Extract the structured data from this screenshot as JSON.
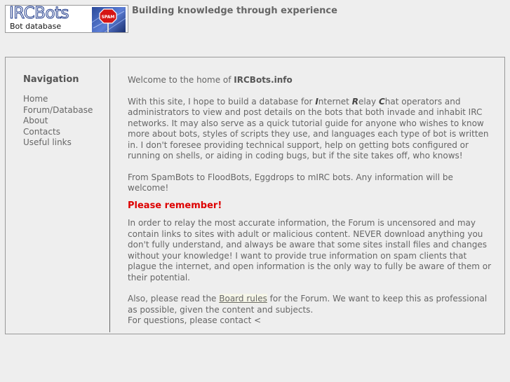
{
  "header": {
    "logo_title": "IRCBots",
    "logo_subtitle": "Bot database",
    "logo_image": "spam-sign-image",
    "tagline": "Building knowledge through experience"
  },
  "nav": {
    "title": "Navigation",
    "items": [
      {
        "label": "Home"
      },
      {
        "label": "Forum/Database"
      },
      {
        "label": "About"
      },
      {
        "label": "Contacts"
      },
      {
        "label": "Useful links"
      }
    ]
  },
  "main": {
    "welcome_prefix": "Welcome to the home of ",
    "welcome_site": "IRCBots.info",
    "intro_1": "With this site, I hope to build a database for ",
    "intro_I": "I",
    "intro_nternet": "nternet ",
    "intro_R": "R",
    "intro_elay": "elay ",
    "intro_C": "C",
    "intro_2": "hat operators and administrators to view and post details on the bots that both invade and inhabit IRC networks. It may also serve as a quick tutorial guide for anyone who wishes to know more about bots, styles of scripts they use, and languages each type of bot is written in. I don't foresee providing technical support, help on getting bots configured or running on shells, or aiding in coding bugs, but if the site takes off, who knows!",
    "from_line": "From SpamBots to FloodBots, Eggdrops to mIRC bots. Any information will be welcome!",
    "remember_heading": "Please remember!",
    "relay_paragraph": "In order to relay the most accurate information, the Forum is uncensored and may contain links to sites with adult or malicious content. NEVER download anything you don't fully understand, and always be aware that some sites install files and changes without your knowledge! I want to provide true information on spam clients that plague the internet, and open information is the only way to fully be aware of them or their potential.",
    "also_prefix": "Also, please read the ",
    "board_rules_link": "Board rules",
    "also_suffix": " for the Forum. We want to keep this as professional as possible, given the content and subjects.",
    "contact_line": "For questions, please contact <"
  },
  "colors": {
    "background": "#eeeeee",
    "text": "#666666",
    "remember_red": "#dd0000",
    "border": "#999999",
    "logo_blue": "#1e3a8a"
  }
}
